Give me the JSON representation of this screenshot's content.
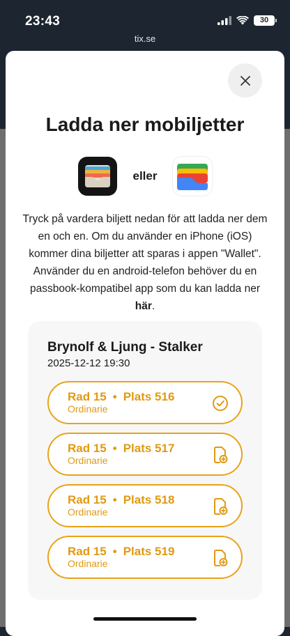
{
  "status_bar": {
    "time": "23:43",
    "battery": "30"
  },
  "browser": {
    "url": "tix.se"
  },
  "modal": {
    "title": "Ladda ner mobiljetter",
    "or_text": "eller",
    "description_text": "Tryck på vardera biljett nedan för att ladda ner dem en och en. Om du använder en iPhone (iOS) kommer dina biljetter att sparas i appen \"Wallet\". Använder du en android-telefon behöver du en passbook-kompatibel app som du kan ladda ner ",
    "description_link": "här",
    "description_end": "."
  },
  "event": {
    "title": "Brynolf & Ljung - Stalker",
    "datetime": "2025-12-12 19:30"
  },
  "tickets": [
    {
      "row": "Rad 15",
      "seat": "Plats 516",
      "category": "Ordinarie",
      "icon": "check-circle-icon"
    },
    {
      "row": "Rad 15",
      "seat": "Plats 517",
      "category": "Ordinarie",
      "icon": "add-to-wallet-icon"
    },
    {
      "row": "Rad 15",
      "seat": "Plats 518",
      "category": "Ordinarie",
      "icon": "add-to-wallet-icon"
    },
    {
      "row": "Rad 15",
      "seat": "Plats 519",
      "category": "Ordinarie",
      "icon": "add-to-wallet-icon"
    }
  ],
  "colors": {
    "accent": "#e8a317",
    "accent_text": "#e09a12",
    "card_background": "#f7f7f7",
    "backdrop": "#6e6e6e"
  }
}
